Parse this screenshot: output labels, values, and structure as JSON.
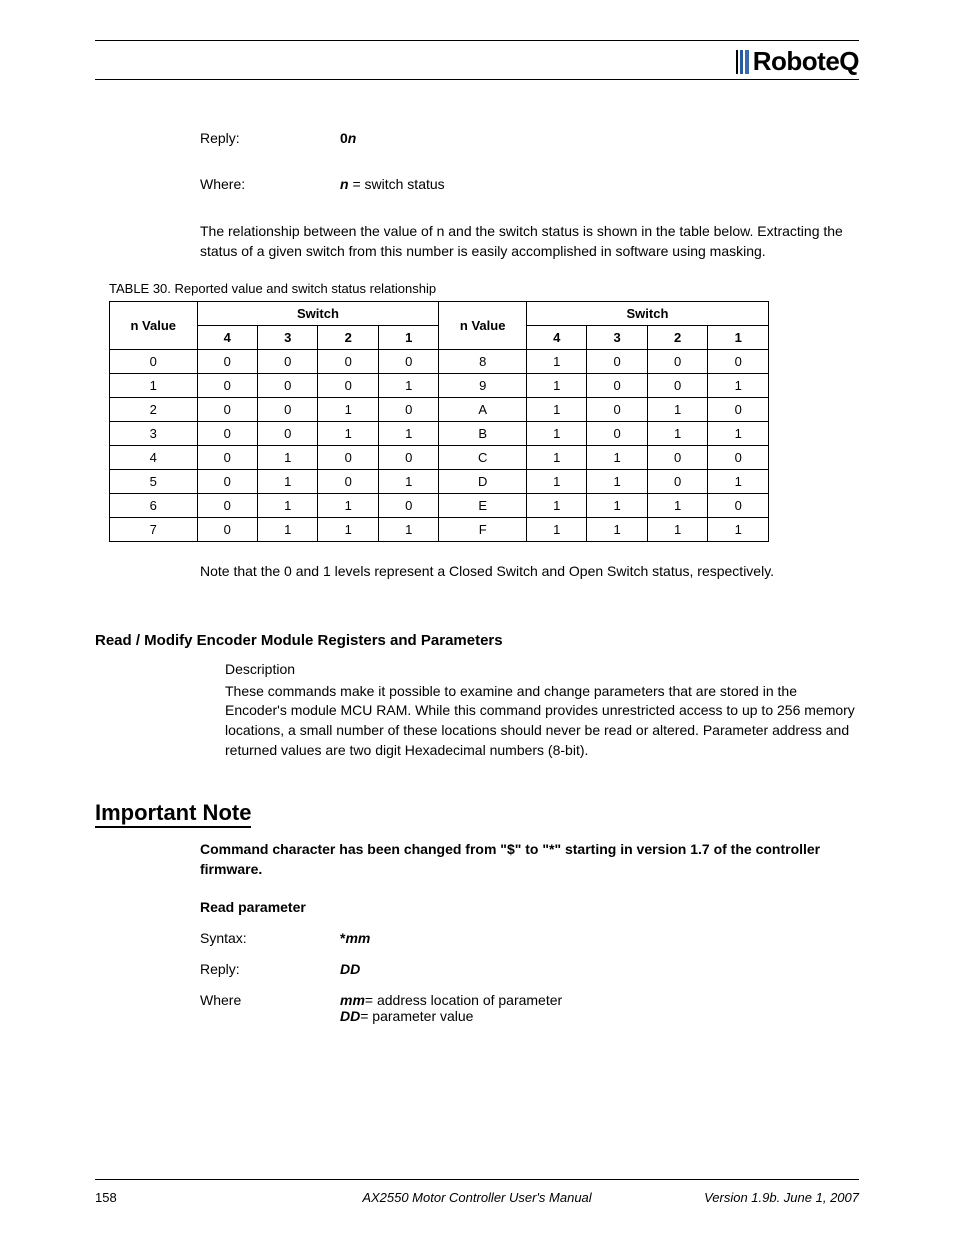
{
  "logo_text": "RoboteQ",
  "reply_label": "Reply:",
  "reply_value_prefix": "0",
  "reply_value_var": "n",
  "where_label": "Where:",
  "where_var": "n",
  "where_desc": " = switch status",
  "para1": "The relationship between the value of n and the switch status is shown in the table below. Extracting the status of a given switch from this number is easily accomplished in software using masking.",
  "table_caption_prefix": "TABLE 30. ",
  "table_caption": "Reported value and switch status relationship",
  "col_nvalue": "n Value",
  "col_switch": "Switch",
  "switch_cols": [
    "4",
    "3",
    "2",
    "1"
  ],
  "rows_left": [
    [
      "0",
      "0",
      "0",
      "0",
      "0"
    ],
    [
      "1",
      "0",
      "0",
      "0",
      "1"
    ],
    [
      "2",
      "0",
      "0",
      "1",
      "0"
    ],
    [
      "3",
      "0",
      "0",
      "1",
      "1"
    ],
    [
      "4",
      "0",
      "1",
      "0",
      "0"
    ],
    [
      "5",
      "0",
      "1",
      "0",
      "1"
    ],
    [
      "6",
      "0",
      "1",
      "1",
      "0"
    ],
    [
      "7",
      "0",
      "1",
      "1",
      "1"
    ]
  ],
  "rows_right": [
    [
      "8",
      "1",
      "0",
      "0",
      "0"
    ],
    [
      "9",
      "1",
      "0",
      "0",
      "1"
    ],
    [
      "A",
      "1",
      "0",
      "1",
      "0"
    ],
    [
      "B",
      "1",
      "0",
      "1",
      "1"
    ],
    [
      "C",
      "1",
      "1",
      "0",
      "0"
    ],
    [
      "D",
      "1",
      "1",
      "0",
      "1"
    ],
    [
      "E",
      "1",
      "1",
      "1",
      "0"
    ],
    [
      "F",
      "1",
      "1",
      "1",
      "1"
    ]
  ],
  "note_para": "Note that the 0 and 1 levels represent a Closed Switch and Open Switch status, respectively.",
  "h2": "Read / Modify Encoder Module Registers and Parameters",
  "desc_label": "Description",
  "desc_para": "These commands make it possible to examine and change parameters that are stored in the Encoder's module MCU RAM. While this command provides unrestricted access to up to 256 memory locations, a small number of these locations should never be read or altered. Parameter address and returned values are two digit Hexadecimal numbers (8-bit).",
  "note_title": "Important Note",
  "note_bold": "Command character has been changed from \"$\" to \"*\" starting in version 1.7 of the controller firmware.",
  "read_param": "Read parameter",
  "syntax_label": "Syntax:",
  "syntax_prefix": "*",
  "syntax_var": "mm",
  "reply2_label": "Reply:",
  "reply2_var": "DD",
  "where2_label": "Where",
  "where2_mm": "mm",
  "where2_mm_desc": "= address location of parameter",
  "where2_dd": "DD",
  "where2_dd_desc": "= parameter value",
  "footer_page": "158",
  "footer_title": "AX2550 Motor Controller User's Manual",
  "footer_version": "Version 1.9b. June 1, 2007"
}
